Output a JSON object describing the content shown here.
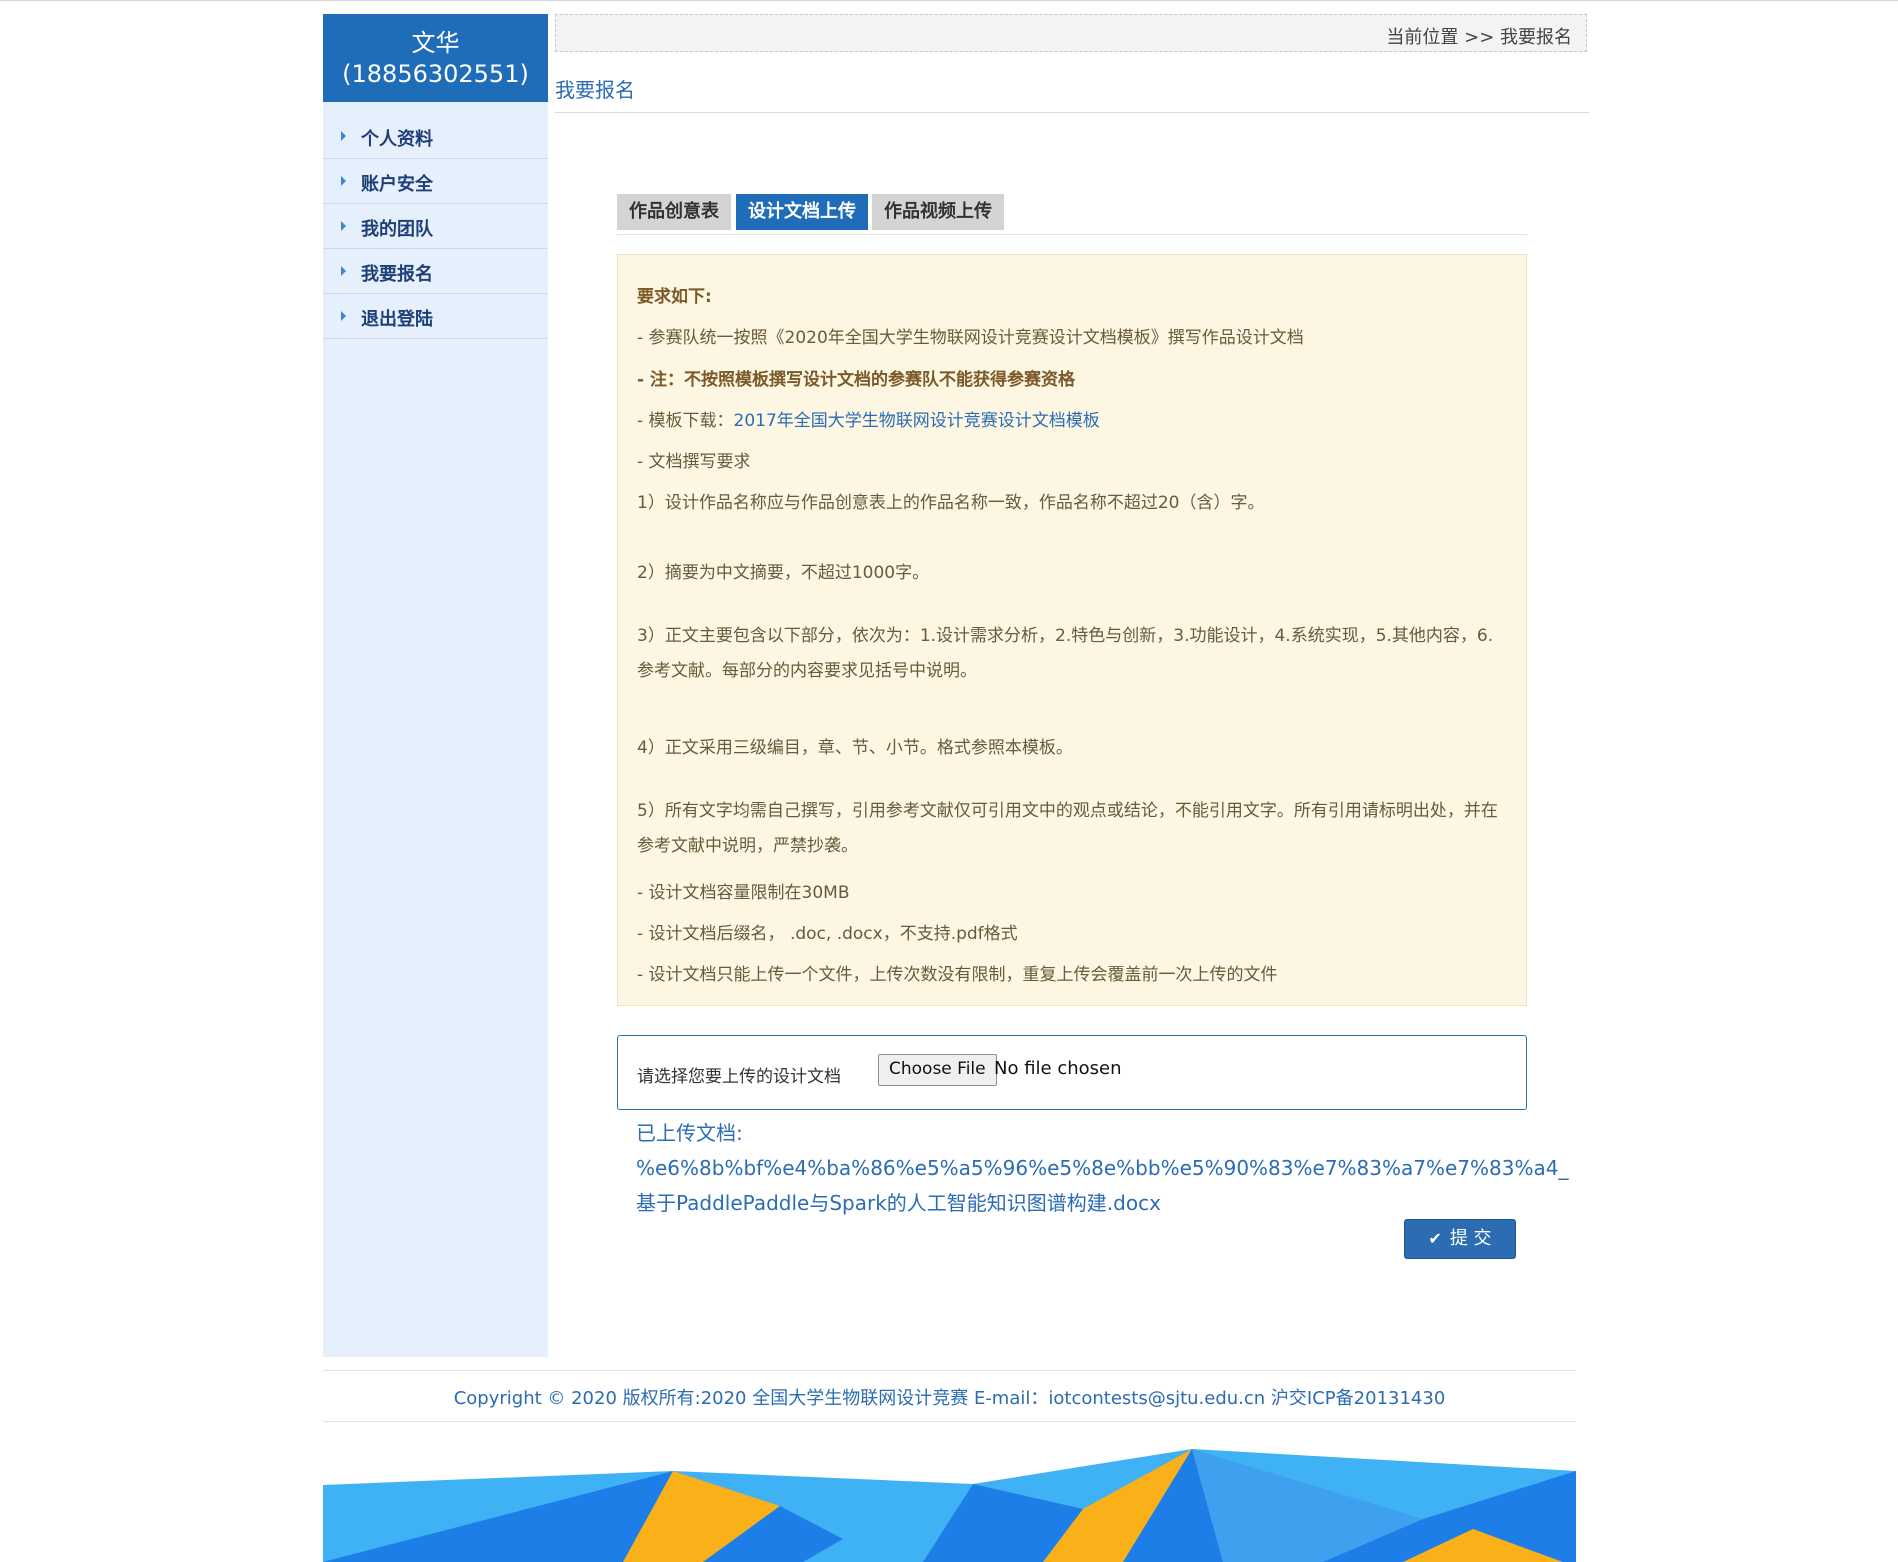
{
  "user": {
    "name": "文华",
    "phone": "(18856302551)"
  },
  "sidebar": {
    "items": [
      {
        "label": "个人资料"
      },
      {
        "label": "账户安全"
      },
      {
        "label": "我的团队"
      },
      {
        "label": "我要报名"
      },
      {
        "label": "退出登陆"
      }
    ]
  },
  "breadcrumb": "当前位置 >> 我要报名",
  "section_title": "我要报名",
  "tabs": [
    {
      "label": "作品创意表",
      "active": false
    },
    {
      "label": "设计文档上传",
      "active": true
    },
    {
      "label": "作品视频上传",
      "active": false
    }
  ],
  "notice": {
    "heading": "要求如下:",
    "line1": "- 参赛队统一按照《2020年全国大学生物联网设计竞赛设计文档模板》撰写作品设计文档",
    "line2": "- 注：不按照模板撰写设计文档的参赛队不能获得参赛资格",
    "line3_prefix": "- 模板下载：",
    "line3_link": "2017年全国大学生物联网设计竞赛设计文档模板",
    "line4": "- 文档撰写要求",
    "req1": "1）设计作品名称应与作品创意表上的作品名称一致，作品名称不超过20（含）字。",
    "req2": "2）摘要为中文摘要，不超过1000字。",
    "req3": "3）正文主要包含以下部分，依次为：1.设计需求分析，2.特色与创新，3.功能设计，4.系统实现，5.其他内容，6.参考文献。每部分的内容要求见括号中说明。",
    "req4": "4）正文采用三级编目，章、节、小节。格式参照本模板。",
    "req5": "5）所有文字均需自己撰写，引用参考文献仅可引用文中的观点或结论，不能引用文字。所有引用请标明出处，并在参考文献中说明，严禁抄袭。",
    "limit1": "- 设计文档容量限制在30MB",
    "limit2": "- 设计文档后缀名， .doc, .docx，不支持.pdf格式",
    "limit3": "- 设计文档只能上传一个文件，上传次数没有限制，重复上传会覆盖前一次上传的文件"
  },
  "upload": {
    "label": "请选择您要上传的设计文档",
    "button": "Choose File",
    "status": "No file chosen"
  },
  "uploaded": {
    "label": "已上传文档:",
    "encoded": "%e6%8b%bf%e4%ba%86%e5%a5%96%e5%8e%bb%e5%90%83%e7%83%a7%e7%83%a4_",
    "filename": "基于PaddlePaddle与Spark的人工智能知识图谱构建.docx"
  },
  "submit": {
    "label": "提 交",
    "icon": "check-icon"
  },
  "footer": "Copyright © 2020 版权所有:2020 全国大学生物联网设计竞赛 E-mail：iotcontests@sjtu.edu.cn 沪交ICP备20131430",
  "colors": {
    "primary": "#1f6cb9",
    "sidebar_bg": "#e6f0fd",
    "notice_bg": "#fcf6e3",
    "banner_blue": "#1e7ee8",
    "banner_light": "#3fb1f5",
    "banner_orange": "#f9b019"
  }
}
